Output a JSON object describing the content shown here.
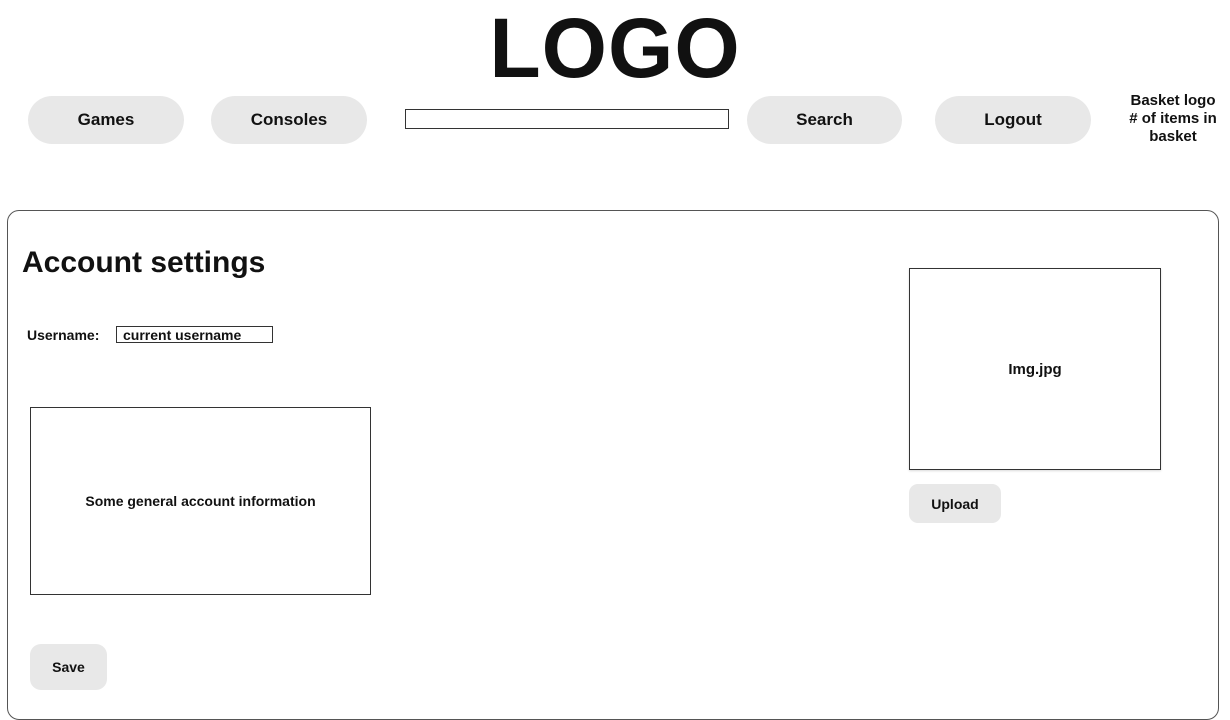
{
  "header": {
    "logo_text": "LOGO",
    "nav": {
      "games_label": "Games",
      "consoles_label": "Consoles",
      "search_label": "Search",
      "logout_label": "Logout"
    },
    "search": {
      "value": "",
      "placeholder": ""
    },
    "basket": {
      "line1": "Basket logo",
      "line2": "# of items in",
      "line3": "basket"
    }
  },
  "main": {
    "title": "Account settings",
    "username": {
      "label": "Username:",
      "value": "current username"
    },
    "info_text": "Some general account information",
    "image": {
      "filename": "Img.jpg",
      "upload_label": "Upload"
    },
    "save_label": "Save"
  },
  "colors": {
    "button_background": "#e8e8e8",
    "text": "#111111",
    "border": "#333333"
  }
}
